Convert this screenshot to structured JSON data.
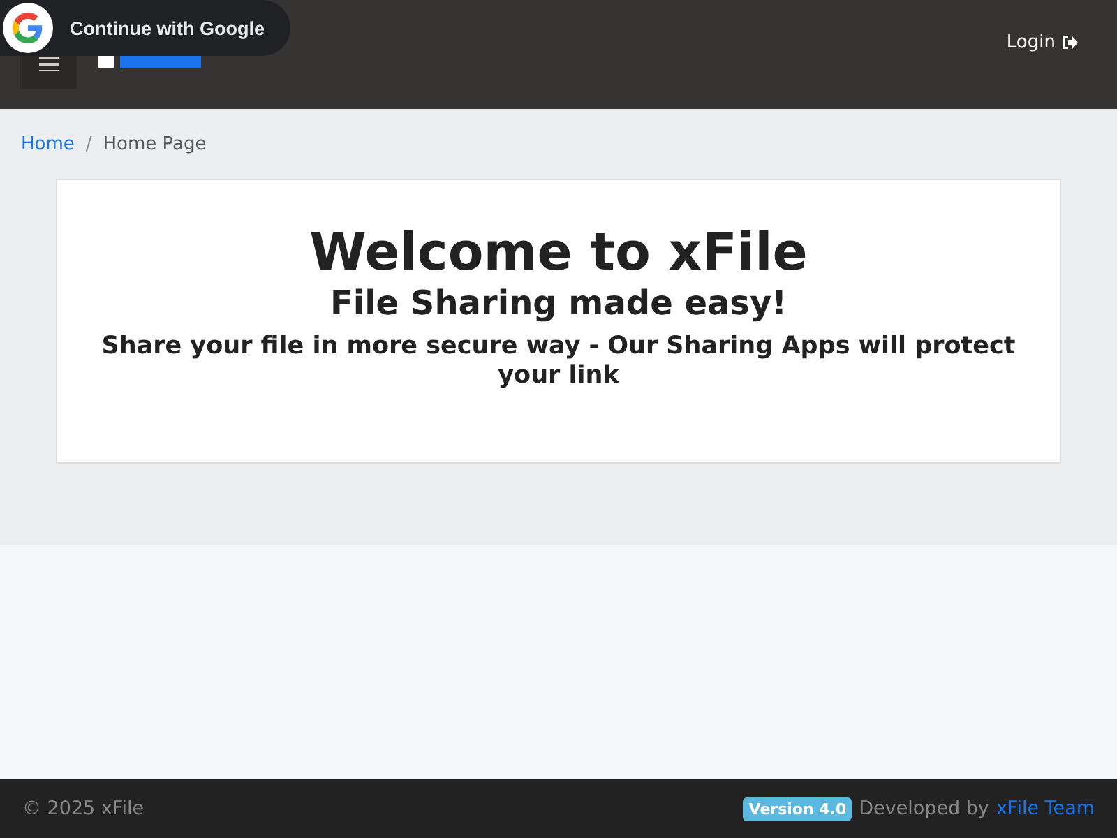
{
  "header": {
    "login": "Login"
  },
  "google_prompt": {
    "label": "Continue with Google"
  },
  "breadcrumb": [
    {
      "label": "Home",
      "selected": false
    },
    {
      "label": "Home Page",
      "selected": true
    }
  ],
  "breadcrumb_separator": "/",
  "hero": {
    "title": "Welcome to xFile",
    "subtitle": "File Sharing made easy!",
    "tagline": "Share your file in more secure way - Our Sharing Apps will protect your link"
  },
  "footer": {
    "copyright": "© 2025 xFile",
    "version": "Version 4.0",
    "developed": "Developed by",
    "team": "xFile Team"
  }
}
